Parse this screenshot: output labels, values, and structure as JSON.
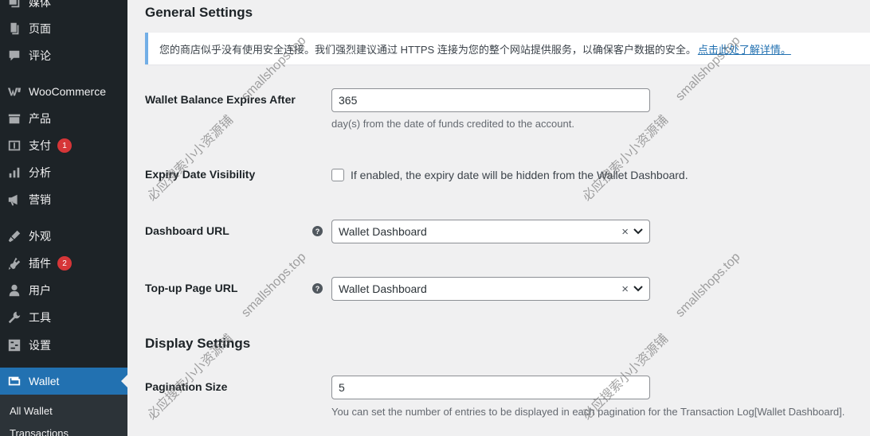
{
  "sidebar": {
    "items": [
      {
        "label": "媒体",
        "icon": "media-icon"
      },
      {
        "label": "页面",
        "icon": "page-icon"
      },
      {
        "label": "评论",
        "icon": "comment-icon"
      },
      {
        "label": "WooCommerce",
        "icon": "woocommerce-icon"
      },
      {
        "label": "产品",
        "icon": "product-icon"
      },
      {
        "label": "支付",
        "icon": "payment-icon",
        "badge": "1"
      },
      {
        "label": "分析",
        "icon": "analytics-icon"
      },
      {
        "label": "营销",
        "icon": "marketing-icon"
      },
      {
        "label": "外观",
        "icon": "appearance-icon"
      },
      {
        "label": "插件",
        "icon": "plugin-icon",
        "badge": "2"
      },
      {
        "label": "用户",
        "icon": "user-icon"
      },
      {
        "label": "工具",
        "icon": "tools-icon"
      },
      {
        "label": "设置",
        "icon": "settings-icon"
      },
      {
        "label": "Wallet",
        "icon": "wallet-icon"
      }
    ],
    "submenu": [
      "All Wallet",
      "Transactions"
    ]
  },
  "main": {
    "general_title": "General Settings",
    "notice_text": "您的商店似乎没有使用安全连接。我们强烈建议通过 HTTPS 连接为您的整个网站提供服务，以确保客户数据的安全。",
    "notice_link": "点击此处了解详情。",
    "expires": {
      "label": "Wallet Balance Expires After",
      "value": "365",
      "desc": "day(s) from the date of funds credited to the account."
    },
    "expiry_visibility": {
      "label": "Expiry Date Visibility",
      "checkbox_label": "If enabled, the expiry date will be hidden from the Wallet Dashboard.",
      "checked": false
    },
    "dashboard_url": {
      "label": "Dashboard URL",
      "value": "Wallet Dashboard",
      "clear": "×"
    },
    "topup_url": {
      "label": "Top-up Page URL",
      "value": "Wallet Dashboard",
      "clear": "×"
    },
    "display_title": "Display Settings",
    "pagination": {
      "label": "Pagination Size",
      "value": "5",
      "desc": "You can set the number of entries to be displayed in each pagination for the Transaction Log[Wallet Dashboard]."
    }
  },
  "watermarks": {
    "site": "smallshops.top",
    "cn": "必应搜索小小资源铺"
  },
  "colors": {
    "sidebar_bg": "#1d2327",
    "active_bg": "#2271b1",
    "badge": "#d63638",
    "notice_border": "#72aee6",
    "link": "#2271b1"
  }
}
